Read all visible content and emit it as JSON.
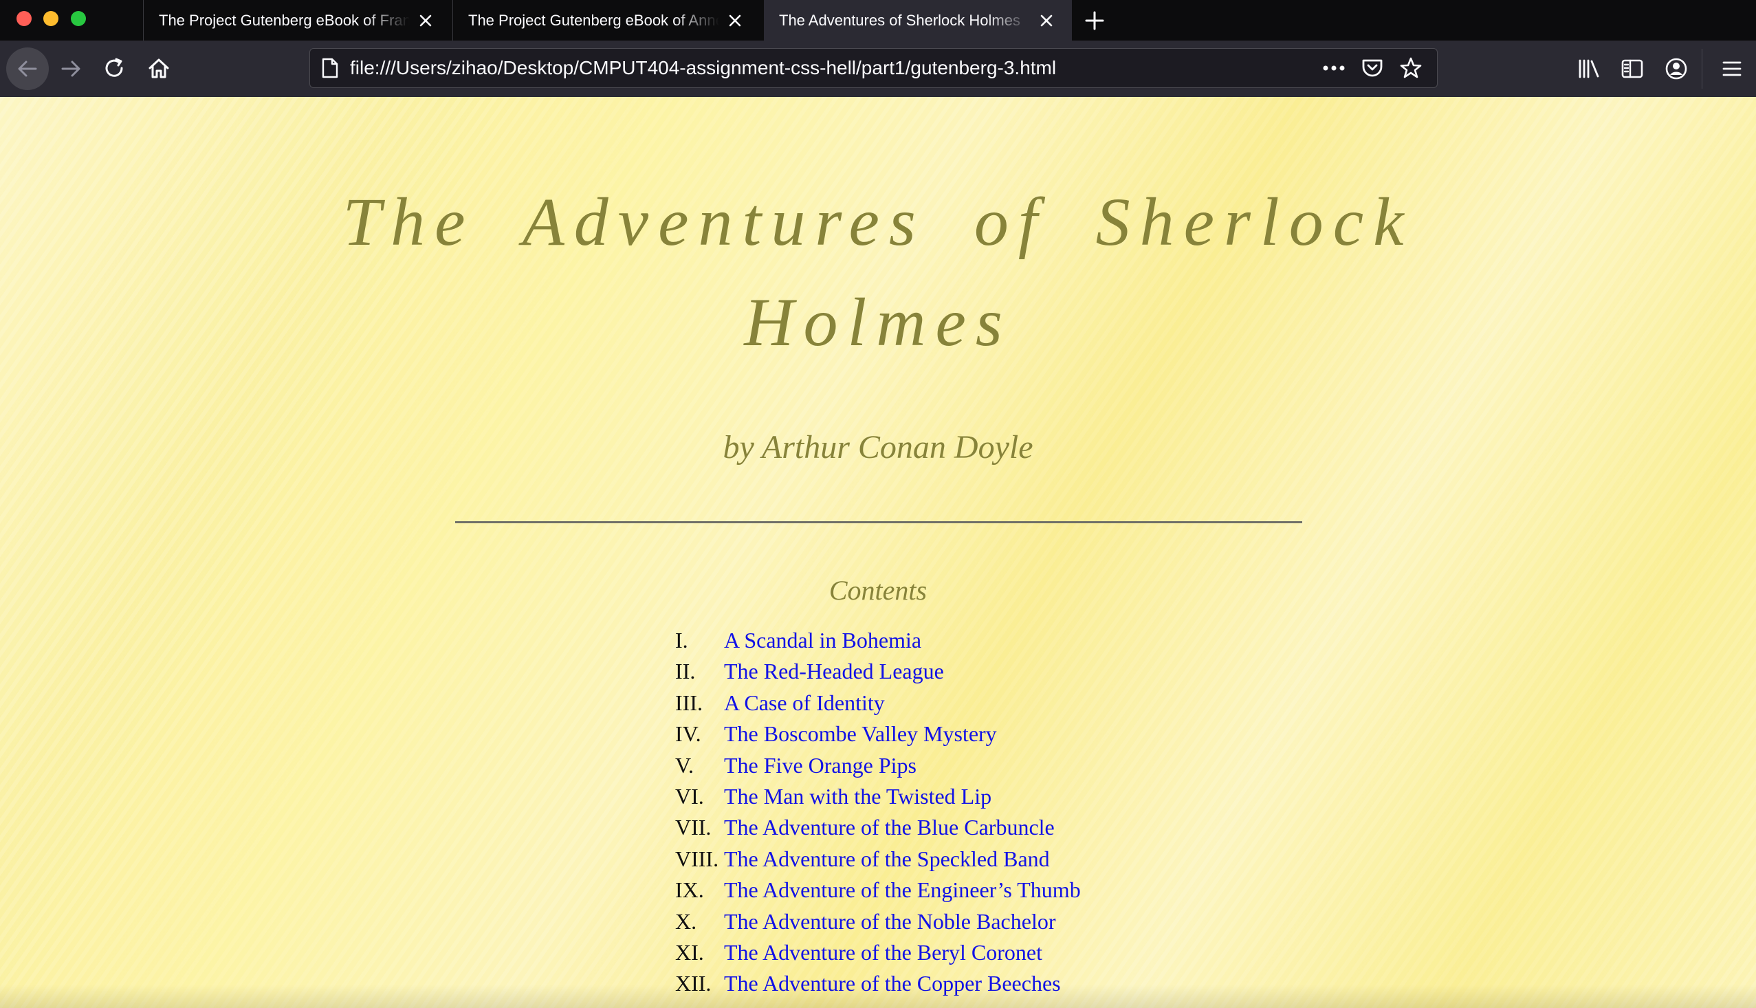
{
  "browser": {
    "tabs": [
      {
        "title": "The Project Gutenberg eBook of Frankenstein",
        "active": false
      },
      {
        "title": "The Project Gutenberg eBook of Anne of Green Gables",
        "active": false
      },
      {
        "title": "The Adventures of Sherlock Holmes",
        "active": true
      }
    ],
    "url": "file:///Users/zihao/Desktop/CMPUT404-assignment-css-hell/part1/gutenberg-3.html",
    "icons": {
      "back": "back-arrow-icon",
      "forward": "forward-arrow-icon",
      "reload": "reload-icon",
      "home": "home-icon",
      "page": "page-icon",
      "more": "more-dots-icon",
      "pocket": "pocket-icon",
      "bookmark": "star-icon",
      "library": "library-icon",
      "sidebar": "sidebar-icon",
      "account": "account-icon",
      "menu": "hamburger-menu-icon"
    }
  },
  "page": {
    "title_line1": "The Adventures of Sherlock",
    "title_line2": "Holmes",
    "byline": "by Arthur Conan Doyle",
    "contents_heading": "Contents",
    "toc": [
      {
        "num": "I.",
        "title": "A Scandal in Bohemia"
      },
      {
        "num": "II.",
        "title": "The Red-Headed League"
      },
      {
        "num": "III.",
        "title": "A Case of Identity"
      },
      {
        "num": "IV.",
        "title": "The Boscombe Valley Mystery"
      },
      {
        "num": "V.",
        "title": "The Five Orange Pips"
      },
      {
        "num": "VI.",
        "title": "The Man with the Twisted Lip"
      },
      {
        "num": "VII.",
        "title": "The Adventure of the Blue Carbuncle"
      },
      {
        "num": "VIII.",
        "title": "The Adventure of the Speckled Band"
      },
      {
        "num": "IX.",
        "title": "The Adventure of the Engineer’s Thumb"
      },
      {
        "num": "X.",
        "title": "The Adventure of the Noble Bachelor"
      },
      {
        "num": "XI.",
        "title": "The Adventure of the Beryl Coronet"
      },
      {
        "num": "XII.",
        "title": "The Adventure of the Copper Beeches"
      }
    ]
  },
  "colors": {
    "title_color": "#87833a",
    "link_color": "#1212e6",
    "page_background": "#fbf2a8",
    "chrome_dark": "#0c0c0d",
    "toolbar": "#2b2a33"
  }
}
